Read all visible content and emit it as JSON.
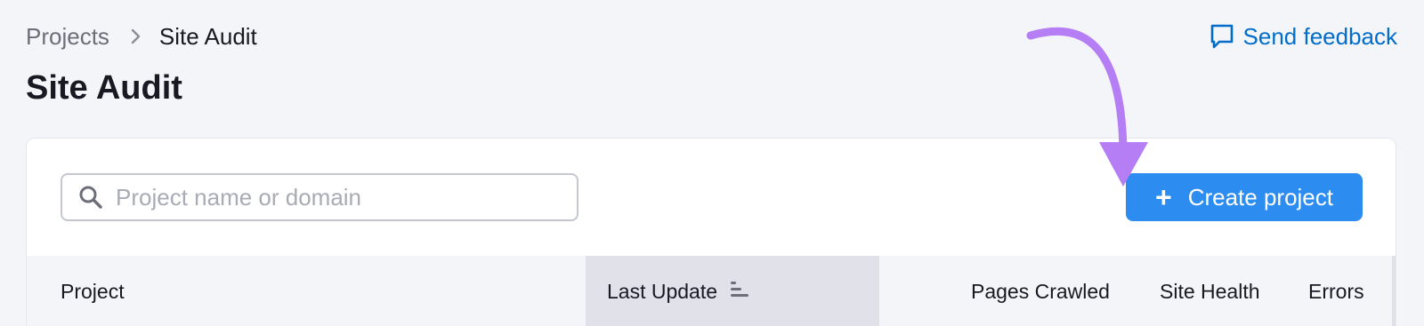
{
  "breadcrumb": {
    "parent": "Projects",
    "current": "Site Audit"
  },
  "page_title": "Site Audit",
  "feedback": {
    "label": "Send feedback",
    "icon": "chat-bubble-icon"
  },
  "search": {
    "placeholder": "Project name or domain",
    "value": "",
    "icon": "search-icon"
  },
  "create_button": {
    "icon": "+",
    "label": "Create project"
  },
  "table": {
    "columns": [
      "Project",
      "Last Update",
      "Pages Crawled",
      "Site Health",
      "Errors"
    ],
    "sorted_column": "Last Update"
  },
  "colors": {
    "accent": "#2d8cf0",
    "link": "#006dca",
    "annotation_arrow": "#b57ef5"
  }
}
